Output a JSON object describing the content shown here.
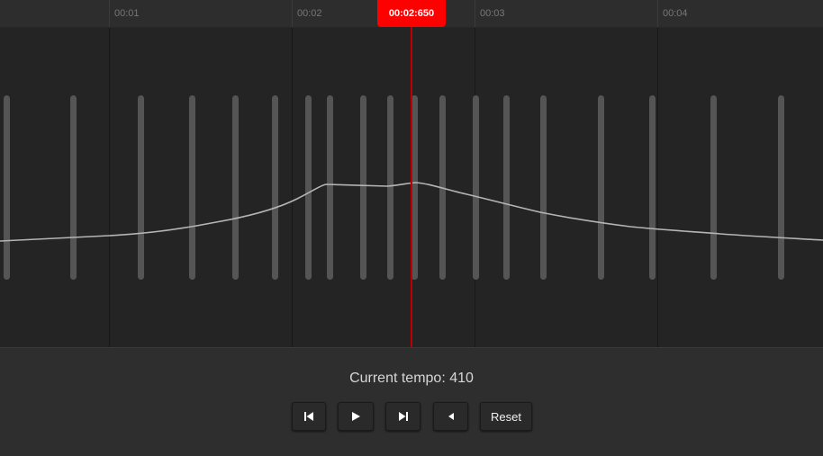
{
  "ruler": {
    "labels": [
      "00:01",
      "00:02",
      "00:03",
      "00:04"
    ]
  },
  "playhead": {
    "time": "00:02:650"
  },
  "status": {
    "tempo_text": "Current tempo: 410"
  },
  "controls": {
    "skip_back_icon": "skip-back-icon",
    "play_icon": "play-icon",
    "skip_forward_icon": "skip-forward-icon",
    "volume_icon": "volume-icon",
    "reset_label": "Reset"
  },
  "colors": {
    "playhead": "#ff0000",
    "beat": "#555555",
    "curve": "#b5b5b5"
  }
}
